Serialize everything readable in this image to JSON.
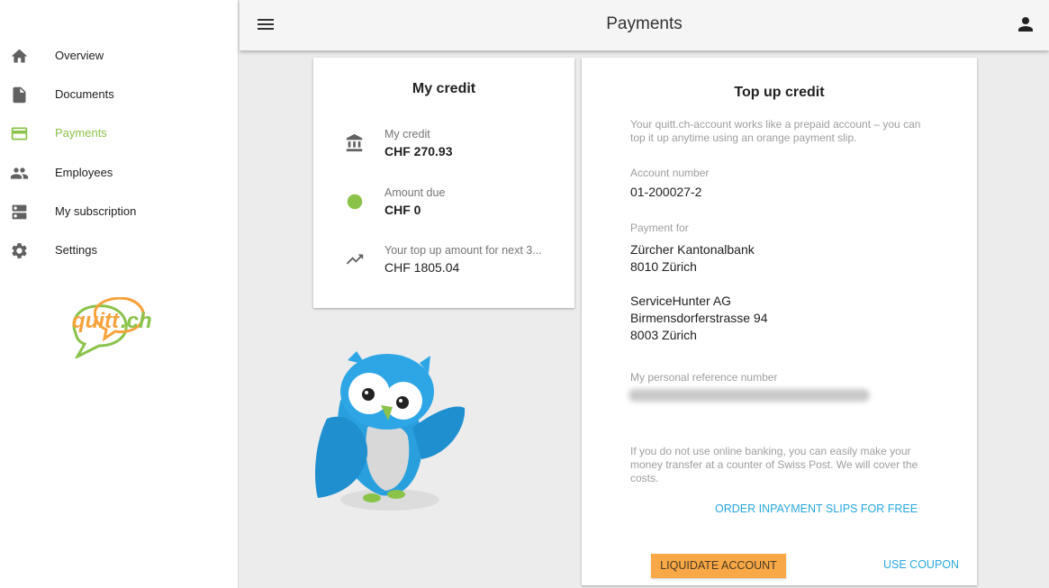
{
  "sidebar": {
    "items": [
      {
        "label": "Overview",
        "icon": "home-icon"
      },
      {
        "label": "Documents",
        "icon": "document-icon"
      },
      {
        "label": "Payments",
        "icon": "credit-card-icon",
        "active": true
      },
      {
        "label": "Employees",
        "icon": "people-icon"
      },
      {
        "label": "My subscription",
        "icon": "subscription-icon"
      },
      {
        "label": "Settings",
        "icon": "gear-icon"
      }
    ],
    "logo": "quitt.ch"
  },
  "header": {
    "title": "Payments"
  },
  "credit": {
    "title": "My credit",
    "rows": [
      {
        "label": "My credit",
        "value": "CHF 270.93",
        "icon": "bank-icon"
      },
      {
        "label": "Amount due",
        "value": "CHF 0",
        "icon": "status-dot-icon"
      },
      {
        "label": "Your top up amount for next 3...",
        "value": "CHF 1805.04",
        "icon": "trending-up-icon"
      }
    ]
  },
  "topup": {
    "title": "Top up credit",
    "intro": "Your quitt.ch-account works like a prepaid account – you can top it up anytime using an orange payment slip.",
    "account_label": "Account number",
    "account_value": "01-200027-2",
    "payment_for_label": "Payment for",
    "bank_name": "Zürcher Kantonalbank",
    "bank_city": "8010 Zürich",
    "company_name": "ServiceHunter AG",
    "company_street": "Birmensdorferstrasse 94",
    "company_city": "8003 Zürich",
    "reference_label": "My personal reference number",
    "post_note": "If you do not use online banking, you can easily make your money transfer at a counter of Swiss Post. We will cover the costs.",
    "order_slips": "ORDER INPAYMENT SLIPS FOR FREE",
    "liquidate": "LIQUIDATE ACCOUNT",
    "coupon": "USE COUPON"
  },
  "colors": {
    "accent_green": "#8bc34a",
    "link_blue": "#29a8e0",
    "button_orange": "#f9a847"
  }
}
